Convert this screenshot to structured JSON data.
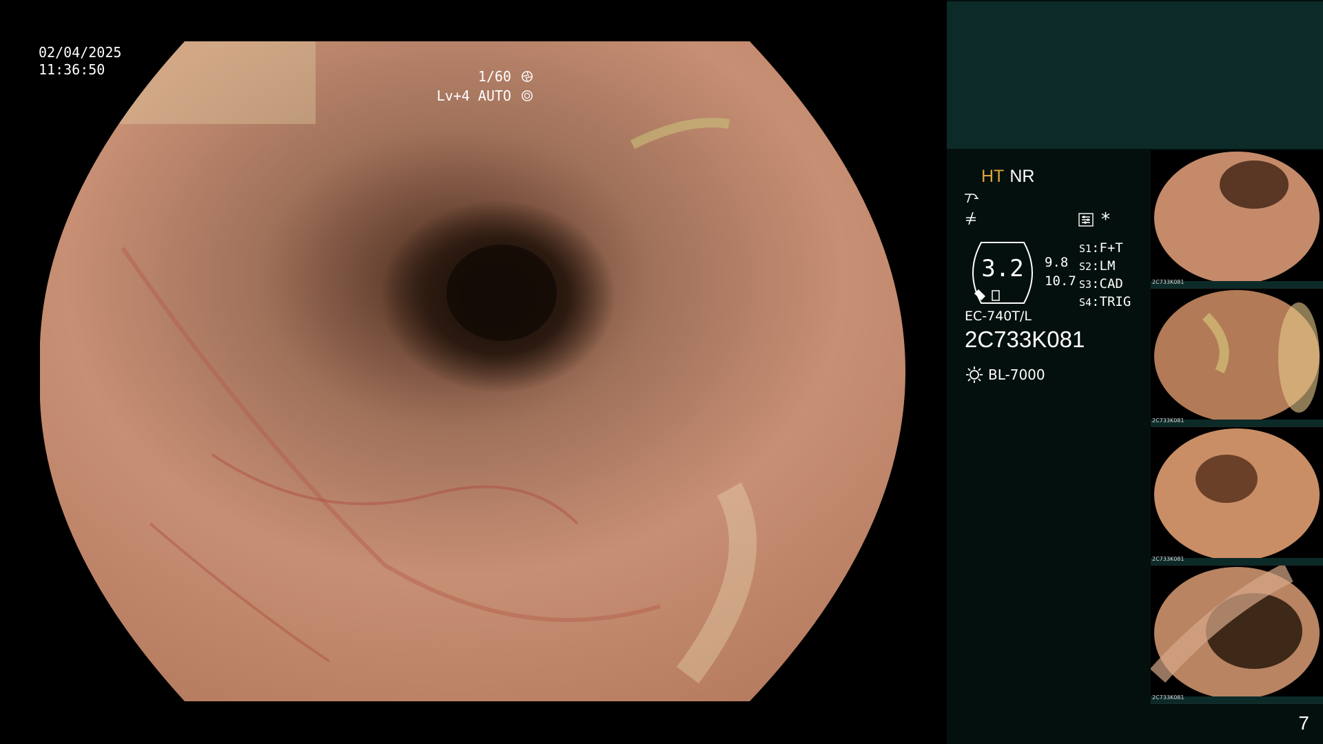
{
  "overlay": {
    "date": "02/04/2025",
    "time": "11:36:50",
    "shutter": "1/60",
    "level": "Lv+4 AUTO"
  },
  "panel": {
    "mode_ht": "HT",
    "mode_nr": "NR",
    "zoom": "3.2",
    "value_a": "9.8",
    "value_b": "10.7",
    "switches": [
      {
        "key": "S1",
        "label": "F+T"
      },
      {
        "key": "S2",
        "label": "LM"
      },
      {
        "key": "S3",
        "label": "CAD"
      },
      {
        "key": "S4",
        "label": "TRIG"
      }
    ],
    "scope_model": "EC-740T/L",
    "scope_serial": "2C733K081",
    "light_source": "BL-7000",
    "asterisk": "*"
  },
  "thumbnails": [
    {
      "serial": "2C733K081"
    },
    {
      "serial": "2C733K081"
    },
    {
      "serial": "2C733K081"
    },
    {
      "serial": "2C733K081"
    }
  ],
  "page_number": "7",
  "colors": {
    "panel_bg": "#04100e",
    "teal_block": "#0c2a28",
    "ht_accent": "#e0a43c"
  }
}
